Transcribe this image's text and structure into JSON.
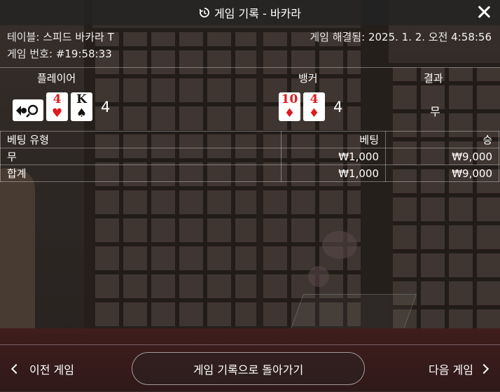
{
  "header": {
    "title": "게임 기록 - 바카라",
    "history_icon": "history-icon",
    "close_icon": "close-icon"
  },
  "meta": {
    "table_label": "테이블:",
    "table_value": "스피드 바카라 T",
    "game_no_label": "게임 번호:",
    "game_no_value": "#19:58:33",
    "resolved_label": "게임 해결됨:",
    "resolved_value": "2025. 1. 2. 오전 4:58:56"
  },
  "result_header": {
    "player": "플레이어",
    "banker": "뱅커",
    "result": "결과"
  },
  "player": {
    "cards": [
      {
        "rank": "",
        "suit": "",
        "color": "#111111",
        "note": "unrevealed/special card"
      },
      {
        "rank": "4",
        "suit": "♥",
        "color": "#e0191e"
      },
      {
        "rank": "K",
        "suit": "♠",
        "color": "#111111"
      }
    ],
    "total": "4"
  },
  "banker": {
    "cards": [
      {
        "rank": "10",
        "suit": "♦",
        "color": "#e0191e"
      },
      {
        "rank": "4",
        "suit": "♦",
        "color": "#e0191e"
      }
    ],
    "total": "4"
  },
  "result": "무",
  "bets": {
    "headers": {
      "type": "베팅 유형",
      "bet": "베팅",
      "win": "승"
    },
    "rows": [
      {
        "type": "무",
        "bet": "₩1,000",
        "win": "₩9,000"
      },
      {
        "type": "합계",
        "bet": "₩1,000",
        "win": "₩9,000"
      }
    ]
  },
  "footer": {
    "prev": "이전 게임",
    "back": "게임 기록으로 돌아가기",
    "next": "다음 게임"
  }
}
